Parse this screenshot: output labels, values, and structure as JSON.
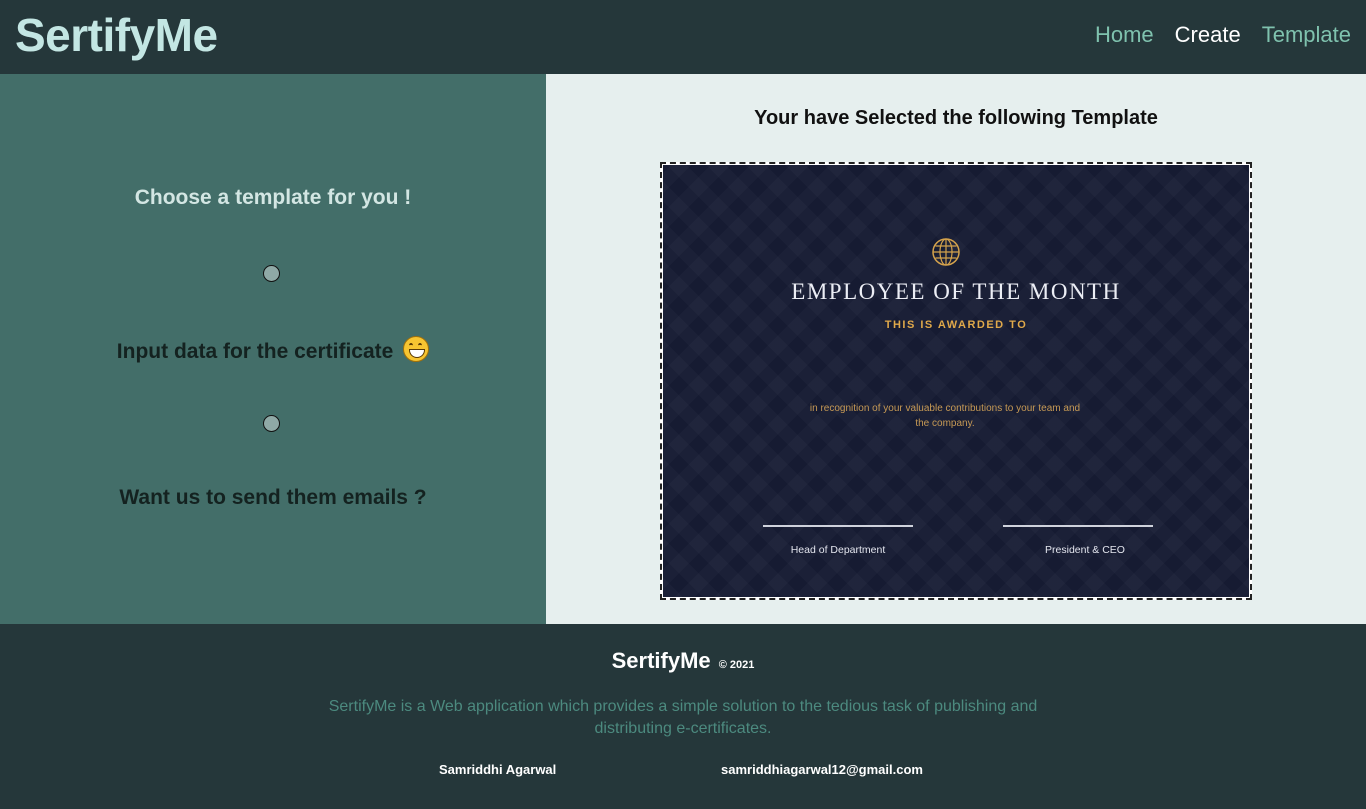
{
  "navbar": {
    "brand": "SertifyMe",
    "links": [
      {
        "label": "Home",
        "active": false
      },
      {
        "label": "Create",
        "active": true
      },
      {
        "label": "Template",
        "active": false
      }
    ]
  },
  "steps": {
    "step1": "Choose a template for you !",
    "step2": "Input data for the certificate",
    "step3": "Want us to send them emails ?"
  },
  "preview": {
    "heading": "Your have Selected the following Template",
    "certificate": {
      "title": "EMPLOYEE OF THE MONTH",
      "subtitle": "THIS IS AWARDED TO",
      "body": "in recognition of your valuable contributions to your team and the company.",
      "signature1": "Head of Department",
      "signature2": "President & CEO",
      "icon": "globe-icon"
    }
  },
  "footer": {
    "brand": "SertifyMe",
    "copyright": "© 2021",
    "description": "SertifyMe is a Web application which provides a simple solution to the tedious task of publishing and distributing e-certificates.",
    "author": "Samriddhi Agarwal",
    "email": "samriddhiagarwal12@gmail.com"
  },
  "colors": {
    "navbar_bg": "#25373a",
    "brand": "#c3e6e3",
    "nav_link": "#7fc2ae",
    "left_panel": "#436e69",
    "right_panel": "#e6efee",
    "certificate_bg": "#161b32",
    "certificate_gold": "#e0a94a"
  }
}
